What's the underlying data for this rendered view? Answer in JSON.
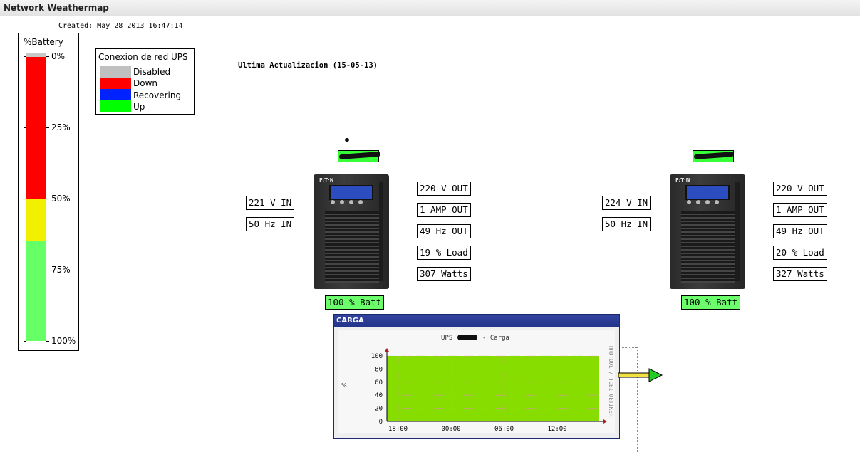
{
  "window": {
    "title": "Network Weathermap"
  },
  "created": "Created: May 28 2013 16:47:14",
  "updated": "Ultima Actualizacion (15-05-13)",
  "battery_legend": {
    "title": "%Battery",
    "ticks": [
      "0%",
      "25%",
      "50%",
      "75%",
      "100%"
    ],
    "colors": {
      "red": "#ff0000",
      "yellow": "#f0f000",
      "green": "#66ff66"
    }
  },
  "key": {
    "title": "Conexion de red UPS",
    "items": [
      {
        "label": "Disabled",
        "color": "#c0c0c0"
      },
      {
        "label": "Down",
        "color": "#ff0000"
      },
      {
        "label": "Recovering",
        "color": "#0022ff"
      },
      {
        "label": "Up",
        "color": "#00ff00"
      }
    ]
  },
  "ups": [
    {
      "in_voltage": "221 V IN",
      "in_freq": "50 Hz IN",
      "out_voltage": "220 V OUT",
      "out_current": "1 AMP OUT",
      "out_freq": "49 Hz OUT",
      "load": "19 % Load",
      "watts": "307 Watts",
      "battery": "100 % Batt",
      "brand": "F:T·N"
    },
    {
      "in_voltage": "224 V IN",
      "in_freq": "50 Hz IN",
      "out_voltage": "220 V OUT",
      "out_current": "1 AMP OUT",
      "out_freq": "49 Hz OUT",
      "load": "20 % Load",
      "watts": "327 Watts",
      "battery": "100 % Batt",
      "brand": "F:T·N"
    }
  ],
  "graph": {
    "header": "CARGA",
    "title_prefix": "UPS",
    "title_suffix": "- Carga",
    "side_label": "RRDTOOL / TOBI OETIKER",
    "ylabel": "%",
    "y_ticks": [
      "100",
      "80",
      "60",
      "40",
      "20",
      "0"
    ],
    "x_ticks": [
      "18:00",
      "00:00",
      "06:00",
      "12:00"
    ]
  },
  "chart_data": {
    "type": "area",
    "title": "",
    "xlabel": "",
    "ylabel": "%",
    "x": [
      "18:00",
      "00:00",
      "06:00",
      "12:00"
    ],
    "series": [
      {
        "values": [
          100,
          100,
          100,
          100
        ],
        "color": "#88dd00"
      }
    ],
    "ylim": [
      0,
      100
    ]
  }
}
